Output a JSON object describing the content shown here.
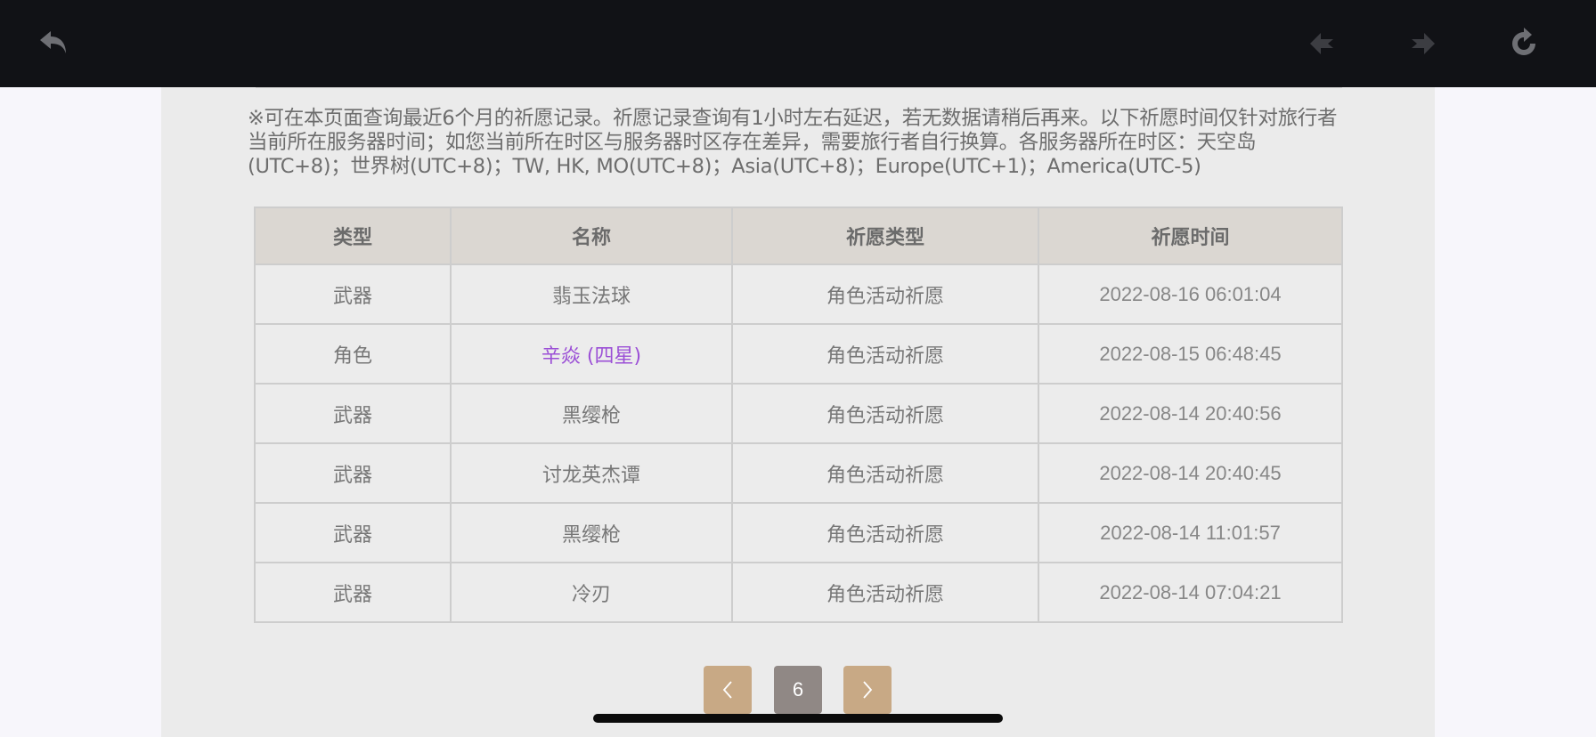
{
  "notice": "※可在本页面查询最近6个月的祈愿记录。祈愿记录查询有1小时左右延迟，若无数据请稍后再来。以下祈愿时间仅针对旅行者当前所在服务器时间；如您当前所在时区与服务器时区存在差异，需要旅行者自行换算。各服务器所在时区：天空岛(UTC+8)；世界树(UTC+8)；TW, HK, MO(UTC+8)；Asia(UTC+8)；Europe(UTC+1)；America(UTC-5)",
  "table": {
    "headers": [
      "类型",
      "名称",
      "祈愿类型",
      "祈愿时间"
    ],
    "rows": [
      {
        "type": "武器",
        "name": "翡玉法球",
        "wish_type": "角色活动祈愿",
        "time": "2022-08-16 06:01:04"
      },
      {
        "type": "角色",
        "name": "辛焱 (四星)",
        "wish_type": "角色活动祈愿",
        "time": "2022-08-15 06:48:45"
      },
      {
        "type": "武器",
        "name": "黑缨枪",
        "wish_type": "角色活动祈愿",
        "time": "2022-08-14 20:40:56"
      },
      {
        "type": "武器",
        "name": "讨龙英杰谭",
        "wish_type": "角色活动祈愿",
        "time": "2022-08-14 20:40:45"
      },
      {
        "type": "武器",
        "name": "黑缨枪",
        "wish_type": "角色活动祈愿",
        "time": "2022-08-14 11:01:57"
      },
      {
        "type": "武器",
        "name": "冷刃",
        "wish_type": "角色活动祈愿",
        "time": "2022-08-14 07:04:21"
      }
    ]
  },
  "pagination": {
    "prev_icon": "chevron-left-icon",
    "current_page": "6",
    "next_icon": "chevron-right-icon"
  },
  "toolbar": {
    "back_icon": "undo-arrow-icon",
    "prev_icon": "nav-back-icon",
    "next_icon": "nav-forward-icon",
    "refresh_icon": "refresh-icon"
  },
  "colors": {
    "toolbar_bg": "#111216",
    "panel_bg": "#ebebeb",
    "header_bg": "#dbd7d2",
    "rare_item": "#9b4fd6",
    "pager_nav": "#c8a985",
    "pager_current": "#908885"
  }
}
